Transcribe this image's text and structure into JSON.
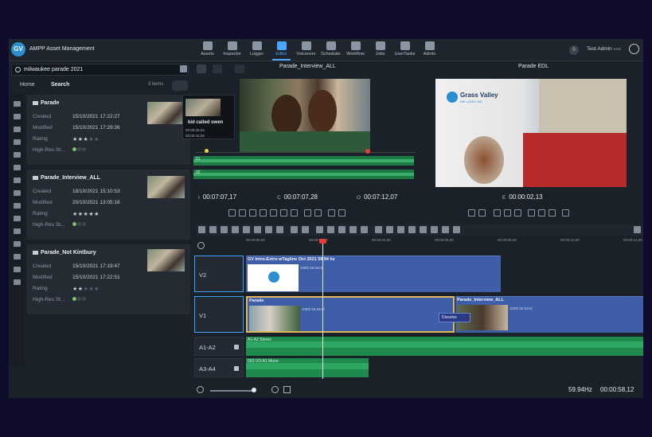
{
  "app": {
    "title": "AMPP Asset Management",
    "logo": "GV"
  },
  "nav": {
    "items": [
      {
        "label": "Assets",
        "icon": "assets-icon",
        "active": false
      },
      {
        "label": "Inspector",
        "icon": "inspector-icon",
        "active": false
      },
      {
        "label": "Logger",
        "icon": "logger-icon",
        "active": false
      },
      {
        "label": "Editor",
        "icon": "editor-icon",
        "active": true
      },
      {
        "label": "Voiceover",
        "icon": "mic-icon",
        "active": false
      },
      {
        "label": "Scheduler",
        "icon": "scheduler-icon",
        "active": false
      },
      {
        "label": "Workflow",
        "icon": "workflow-icon",
        "active": false
      },
      {
        "label": "Jobs",
        "icon": "jobs-icon",
        "active": false
      },
      {
        "label": "UserTasks",
        "icon": "usertasks-icon",
        "active": false
      },
      {
        "label": "Admin",
        "icon": "admin-icon",
        "active": false
      }
    ]
  },
  "header": {
    "notifications": "0",
    "user": "Test Admin",
    "user_suffix": "ENG"
  },
  "search": {
    "value": "milwaukee parade 2021",
    "home": "Home",
    "search_label": "Search",
    "count": "3 items"
  },
  "assets": [
    {
      "title": "Parade",
      "created": "15/10/2021 17:22:27",
      "modified": "15/10/2021 17:29:36",
      "rating": 3,
      "stars": "★★★",
      "stars_off": "★★",
      "highres_dots": 1
    },
    {
      "title": "Parade_Interview_ALL",
      "created": "18/10/2021 15:10:53",
      "modified": "20/10/2021 13:05:16",
      "rating": 5,
      "stars": "★★★★★",
      "stars_off": "",
      "highres_dots": 1
    },
    {
      "title": "Parade_Not Kintbury",
      "created": "15/10/2021 17:19:47",
      "modified": "15/10/2021 17:22:51",
      "rating": 2,
      "stars": "★★",
      "stars_off": "★★★",
      "highres_dots": 1
    }
  ],
  "labels": {
    "created": "Created",
    "modified": "Modified",
    "rating": "Rating",
    "highres": "High-Res St..."
  },
  "tooltip": {
    "title": "kid called owen",
    "tc_in": "00:00:28,04",
    "tc_out": "00:00:42,09"
  },
  "source_monitor": {
    "title": "Parade_Interview_ALL",
    "tc_i": "00:07:07,17",
    "tc_c": "00:07:07,28",
    "tc_o": "00:07:12,07",
    "i_label": "I",
    "c_label": "C",
    "o_label": "O",
    "audio1": "01",
    "audio2": "02"
  },
  "program_monitor": {
    "title": "Parade EDL",
    "tc_e": "00:00:02,13",
    "e_label": "E",
    "brand": "Grass Valley",
    "brand_sub": "WE LOVE LIVE",
    "brand_logo": "GV"
  },
  "timeline": {
    "ruler": [
      "00:00:00,00",
      "00:00:02,00",
      "00:00:04,00",
      "00:00:06,00",
      "00:00:08,00",
      "00:00:10,00",
      "00:00:12,00"
    ],
    "tracks": [
      {
        "name": "V2"
      },
      {
        "name": "V1"
      },
      {
        "name": "A1-A2"
      },
      {
        "name": "A3-A4"
      }
    ],
    "clips": {
      "v2_title": "GV Intro-Extro wTagline Oct 2021 59.94 hz",
      "v2_spec": "1080i 59.94Hz",
      "v1a_title": "Parade",
      "v1a_spec": "1080i 59.94Hz",
      "v1b_title": "Parade_Interview_ALL",
      "v1b_spec": "1080i 59.94Hz",
      "transition": "Dissolve",
      "a1_title": "A1-A2 Stereo",
      "a3_title": "002-VO:A1 Mono"
    }
  },
  "footer": {
    "framerate": "59.94Hz",
    "duration": "00:00:58,12"
  }
}
